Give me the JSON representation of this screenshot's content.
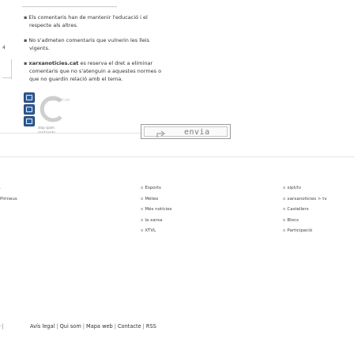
{
  "rules": {
    "rule1_line1": "Els comentaris han de mantenir l'educació i el",
    "rule1_line2": "respecte als altres.",
    "rule2_line1": "No s'admeten comentaris que vulnerin les lleis",
    "rule2_line2": "vigents.",
    "rule3_site": "xarxanoticies.cat",
    "rule3_line1_rest": " es reserva el dret a eliminar",
    "rule3_line2": "comentaris que no s'atenguin a aquestes normes o",
    "rule3_line3": "que no guardin relació amb el tema."
  },
  "side": {
    "digit": "4"
  },
  "captcha": {
    "brand": "reCAPTCHA",
    "stop_spam_line1": "stop spam.",
    "stop_spam_line2": "read books."
  },
  "send_button": {
    "label": "envia"
  },
  "footer": {
    "left": [
      {
        "text": ""
      },
      {
        "text": "Pirineus"
      }
    ],
    "middle": [
      {
        "text": "Esports"
      },
      {
        "text": "Méteo"
      },
      {
        "text": "Més notícies"
      },
      {
        "text": "la xarxa"
      },
      {
        "text": "XTVL"
      }
    ],
    "right": [
      {
        "text": "xipt/tv"
      },
      {
        "text": "xarxanoticies > tv"
      },
      {
        "text": "Castellers"
      },
      {
        "text": "Blocs"
      },
      {
        "text": "Participació"
      }
    ],
    "legal_links": {
      "avis": "Avís legal",
      "qui": "Qui som",
      "mapa": "Mapa web",
      "contacte": "Contacte",
      "rss": "RSS"
    }
  },
  "colors": {
    "captcha_blue": "#2d5f9e",
    "text": "#333333",
    "border": "#9a9a9a"
  }
}
